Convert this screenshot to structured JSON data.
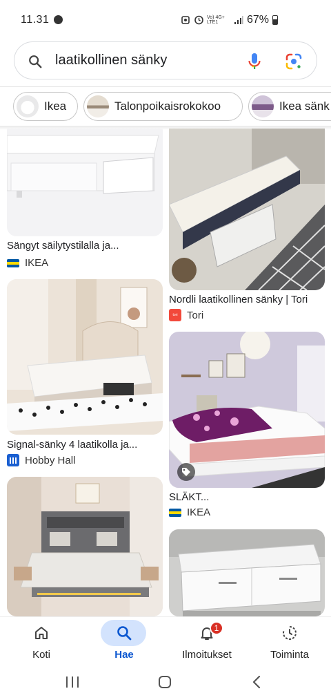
{
  "status_bar": {
    "time": "11.31",
    "network_label": "Vo) 4G+ LTE1",
    "battery": "67%"
  },
  "search": {
    "query": "laatikollinen sänky",
    "icons": [
      "search-icon",
      "mic-icon",
      "google-lens-icon"
    ]
  },
  "chips": [
    {
      "label": "Ikea"
    },
    {
      "label": "Talonpoikaisrokokoo"
    },
    {
      "label": "Ikea sänk"
    }
  ],
  "results": {
    "left": [
      {
        "title": "Sängyt säilytystilalla ja...",
        "source": "IKEA",
        "favicon": "ikea"
      },
      {
        "title": "Signal-sänky 4 laatikolla ja...",
        "source": "Hobby Hall",
        "favicon": "hobby-hall"
      },
      {
        "title": "",
        "source": "",
        "favicon": ""
      }
    ],
    "right": [
      {
        "title": "Nordli laatikollinen sänky | Tori",
        "source": "Tori",
        "favicon": "tori"
      },
      {
        "title": "SLÄKT...",
        "source": "IKEA",
        "favicon": "ikea"
      },
      {
        "title": "",
        "source": "",
        "favicon": ""
      }
    ]
  },
  "favicon_text": {
    "tori": "tori"
  },
  "bottom_nav": [
    {
      "label": "Koti",
      "icon": "home-icon",
      "active": false
    },
    {
      "label": "Hae",
      "icon": "search-icon",
      "active": true
    },
    {
      "label": "Ilmoitukset",
      "icon": "bell-icon",
      "active": false,
      "badge": "1"
    },
    {
      "label": "Toiminta",
      "icon": "activity-icon",
      "active": false
    }
  ],
  "colors": {
    "accent": "#0b57d0",
    "active_pill": "#d3e3fd",
    "badge": "#d93025"
  }
}
